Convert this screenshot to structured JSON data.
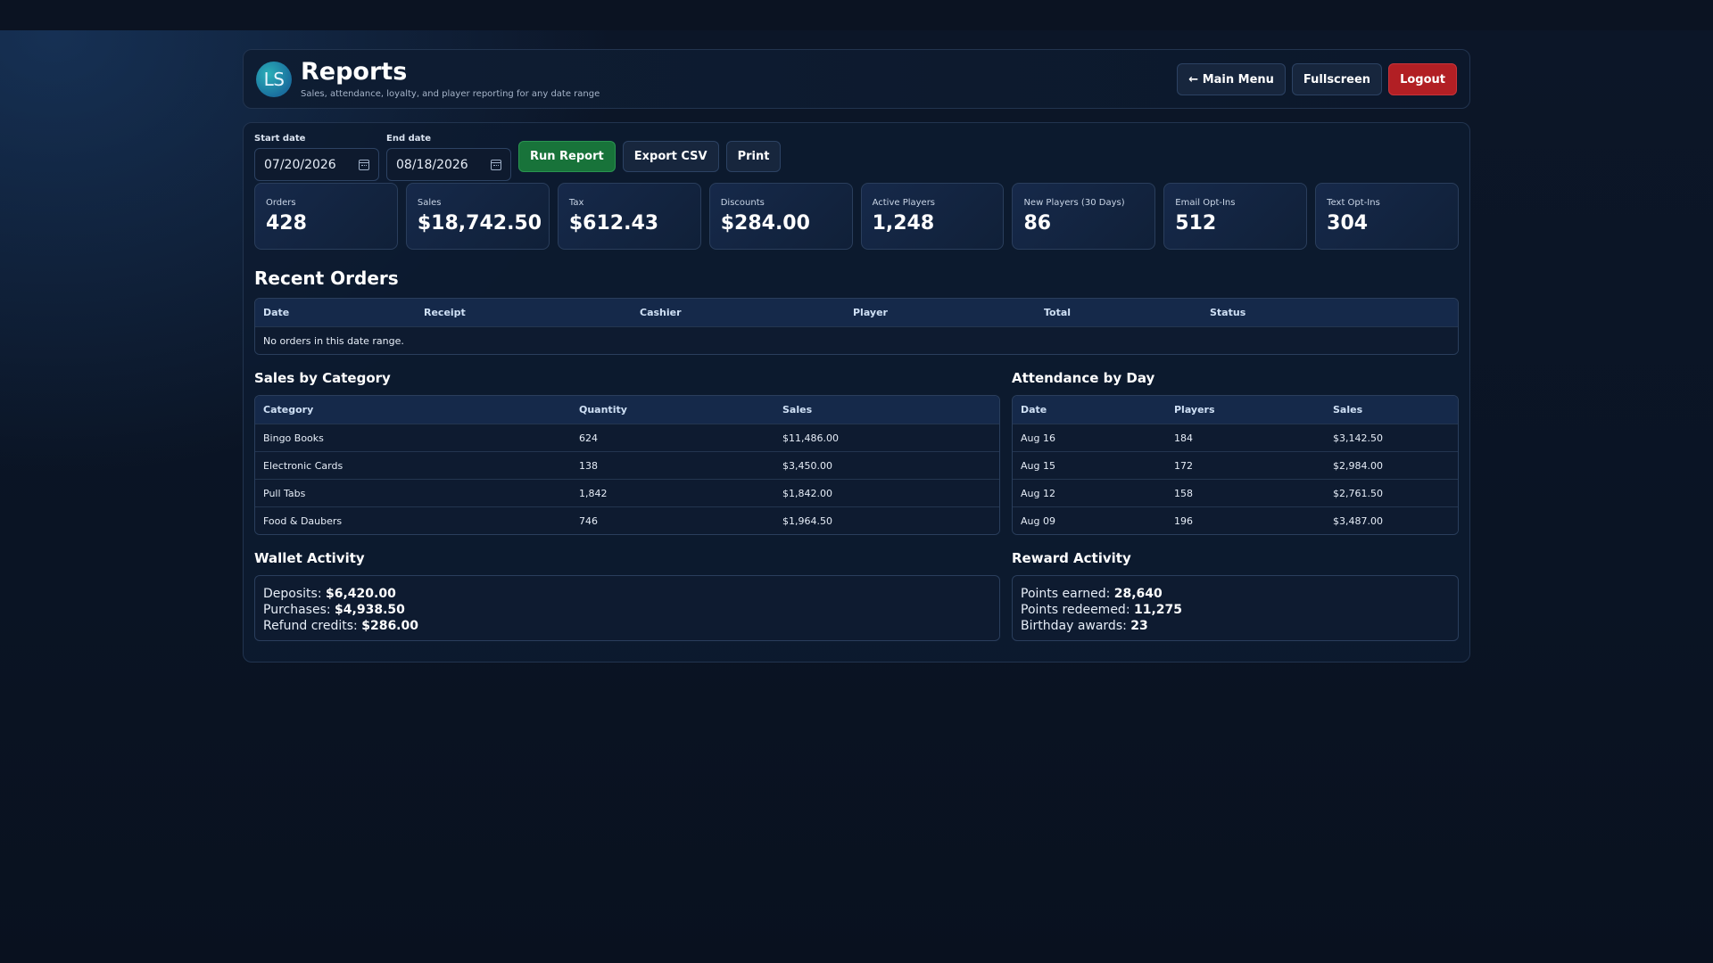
{
  "header": {
    "logo_text": "LS",
    "title": "Reports",
    "subtitle": "Sales, attendance, loyalty, and player reporting for any date range",
    "buttons": {
      "main_menu": "← Main Menu",
      "fullscreen": "Fullscreen",
      "logout": "Logout"
    }
  },
  "controls": {
    "start_label": "Start date",
    "start_value": "07/20/2026",
    "end_label": "End date",
    "end_value": "08/18/2026",
    "run": "Run Report",
    "export": "Export CSV",
    "print": "Print"
  },
  "stats": [
    {
      "label": "Orders",
      "value": "428"
    },
    {
      "label": "Sales",
      "value": "$18,742.50"
    },
    {
      "label": "Tax",
      "value": "$612.43"
    },
    {
      "label": "Discounts",
      "value": "$284.00"
    },
    {
      "label": "Active Players",
      "value": "1,248"
    },
    {
      "label": "New Players (30 Days)",
      "value": "86"
    },
    {
      "label": "Email Opt-Ins",
      "value": "512"
    },
    {
      "label": "Text Opt-Ins",
      "value": "304"
    }
  ],
  "recent_orders": {
    "title": "Recent Orders",
    "columns": [
      "Date",
      "Receipt",
      "Cashier",
      "Player",
      "Total",
      "Status"
    ],
    "empty": "No orders in this date range."
  },
  "sales_by_category": {
    "title": "Sales by Category",
    "columns": [
      "Category",
      "Quantity",
      "Sales"
    ],
    "rows": [
      [
        "Bingo Books",
        "624",
        "$11,486.00"
      ],
      [
        "Electronic Cards",
        "138",
        "$3,450.00"
      ],
      [
        "Pull Tabs",
        "1,842",
        "$1,842.00"
      ],
      [
        "Food & Daubers",
        "746",
        "$1,964.50"
      ]
    ]
  },
  "attendance_by_day": {
    "title": "Attendance by Day",
    "columns": [
      "Date",
      "Players",
      "Sales"
    ],
    "rows": [
      [
        "Aug 16",
        "184",
        "$3,142.50"
      ],
      [
        "Aug 15",
        "172",
        "$2,984.00"
      ],
      [
        "Aug 12",
        "158",
        "$2,761.50"
      ],
      [
        "Aug 09",
        "196",
        "$3,487.00"
      ]
    ]
  },
  "wallet_activity": {
    "title": "Wallet Activity",
    "deposits_label": "Deposits:",
    "deposits": "$6,420.00",
    "purchases_label": "Purchases:",
    "purchases": "$4,938.50",
    "refunds_label": "Refund credits:",
    "refunds": "$286.00"
  },
  "reward_activity": {
    "title": "Reward Activity",
    "earned_label": "Points earned:",
    "earned": "28,640",
    "redeemed_label": "Points redeemed:",
    "redeemed": "11,275",
    "birthday_label": "Birthday awards:",
    "birthday": "23"
  }
}
